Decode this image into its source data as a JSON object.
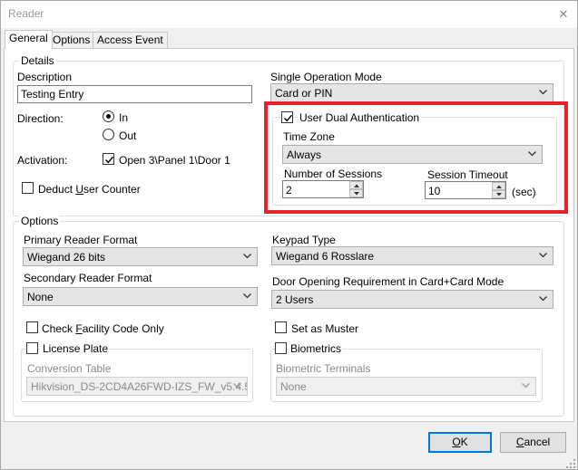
{
  "window": {
    "title": "Reader",
    "close_glyph": "✕"
  },
  "tabs": [
    {
      "label": "General",
      "active": true
    },
    {
      "label": "Options",
      "active": false
    },
    {
      "label": "Access Event",
      "active": false
    }
  ],
  "details": {
    "legend": "Details",
    "description_label": "Description",
    "description_value": "Testing Entry",
    "direction_label": "Direction:",
    "direction_in": "In",
    "direction_out": "Out",
    "direction_selected": "In",
    "activation_label": "Activation:",
    "activation_value": "Open 3\\Panel 1\\Door 1",
    "activation_checked": true,
    "deduct_label_pre": "Deduct ",
    "deduct_label_u": "U",
    "deduct_label_post": "ser Counter",
    "deduct_checked": false,
    "single_op_label": "Single Operation Mode",
    "single_op_value": "Card or PIN"
  },
  "dual_auth": {
    "checkbox_label": "User Dual Authentication",
    "checked": true,
    "time_zone_label": "Time Zone",
    "time_zone_value": "Always",
    "sessions_label": "Number of Sessions",
    "sessions_value": "2",
    "timeout_label": "Session Timeout",
    "timeout_value": "10",
    "timeout_unit": "(sec)",
    "highlight_color": "#e8212a"
  },
  "options": {
    "legend": "Options",
    "primary_format_label": "Primary Reader Format",
    "primary_format_value": "Wiegand 26 bits",
    "secondary_format_label": "Secondary Reader Format",
    "secondary_format_value": "None",
    "keypad_label": "Keypad Type",
    "keypad_value": "Wiegand 6 Rosslare",
    "door_req_label": "Door Opening Requirement in Card+Card Mode",
    "door_req_value": "2 Users",
    "facility_pre": "Check ",
    "facility_u": "F",
    "facility_post": "acility Code Only",
    "facility_checked": false,
    "muster_label": "Set as Muster",
    "muster_checked": false,
    "license_label": "License Plate",
    "license_checked": false,
    "conversion_label": "Conversion Table",
    "conversion_value": "Hikvision_DS-2CD4A26FWD-IZS_FW_v5.4.5",
    "biometrics_label": "Biometrics",
    "biometrics_checked": false,
    "bio_terminals_label": "Biometric Terminals",
    "bio_terminals_value": "None"
  },
  "buttons": {
    "ok_u": "O",
    "ok_rest": "K",
    "cancel_u": "C",
    "cancel_rest": "ancel"
  }
}
